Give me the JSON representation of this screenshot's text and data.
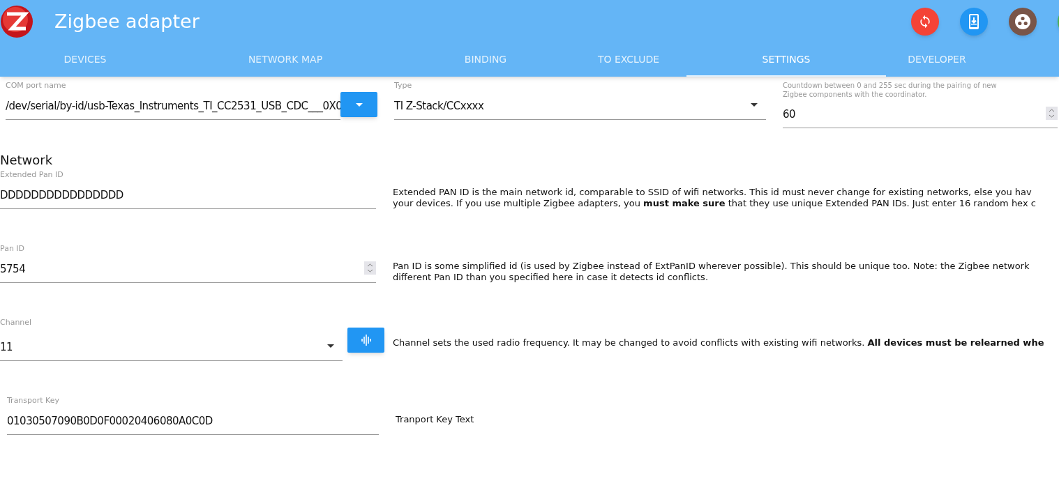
{
  "app_bar": {
    "title": "Zigbee adapter",
    "actions": [
      {
        "kind": "sync",
        "color": "#f44336"
      },
      {
        "kind": "download",
        "color": "#2196f3"
      },
      {
        "kind": "dots",
        "color": "#795548"
      },
      {
        "kind": "partial",
        "color": "#4caf50"
      }
    ]
  },
  "tabs": [
    {
      "label": "DEVICES",
      "selected": false
    },
    {
      "label": "NETWORK MAP",
      "selected": false
    },
    {
      "label": "BINDING",
      "selected": false
    },
    {
      "label": "TO EXCLUDE",
      "selected": false
    },
    {
      "label": "SETTINGS",
      "selected": true
    },
    {
      "label": "DEVELOPER",
      "selected": false
    }
  ],
  "top_fields": [
    {
      "kind": "text-button",
      "label": "COM port name",
      "value": "/dev/serial/by-id/usb-Texas_Instruments_TI_CC2531_USB_CDC___0X0"
    },
    {
      "kind": "select",
      "label": "Type",
      "value": "TI Z-Stack/CCxxxx"
    },
    {
      "kind": "number",
      "label": "Countdown between 0 and 255 sec during the pairing of new Zigbee components with the coordinator.",
      "value": "60"
    }
  ],
  "network": {
    "heading": "Network",
    "fields": [
      {
        "kind": "text",
        "label": "Extended Pan ID",
        "value": "DDDDDDDDDDDDDDDD",
        "description": "Extended PAN ID is the main network id, comparable to SSID of wifi networks. This id must never change for existing networks, else you hav\nyour devices. If you use multiple Zigbee adapters, you **must make sure** that they use unique Extended PAN IDs. Just enter 16 random hex c"
      },
      {
        "kind": "number",
        "label": "Pan ID",
        "value": "5754",
        "description": "Pan ID is some simplified id (is used by Zigbee instead of ExtPanID wherever possible). This should be unique too. Note: the Zigbee network\ndifferent Pan ID than you specified here in case it detects id conflicts."
      },
      {
        "kind": "select-button",
        "label": "Channel",
        "value": "11",
        "description": "Channel sets the used radio frequency. It may be changed to avoid conflicts with existing wifi networks. **All devices must be relearned whe**"
      },
      {
        "kind": "key",
        "label": "Transport Key",
        "value": "01030507090B0D0F00020406080A0C0D",
        "description": "Tranport Key Text"
      }
    ]
  }
}
